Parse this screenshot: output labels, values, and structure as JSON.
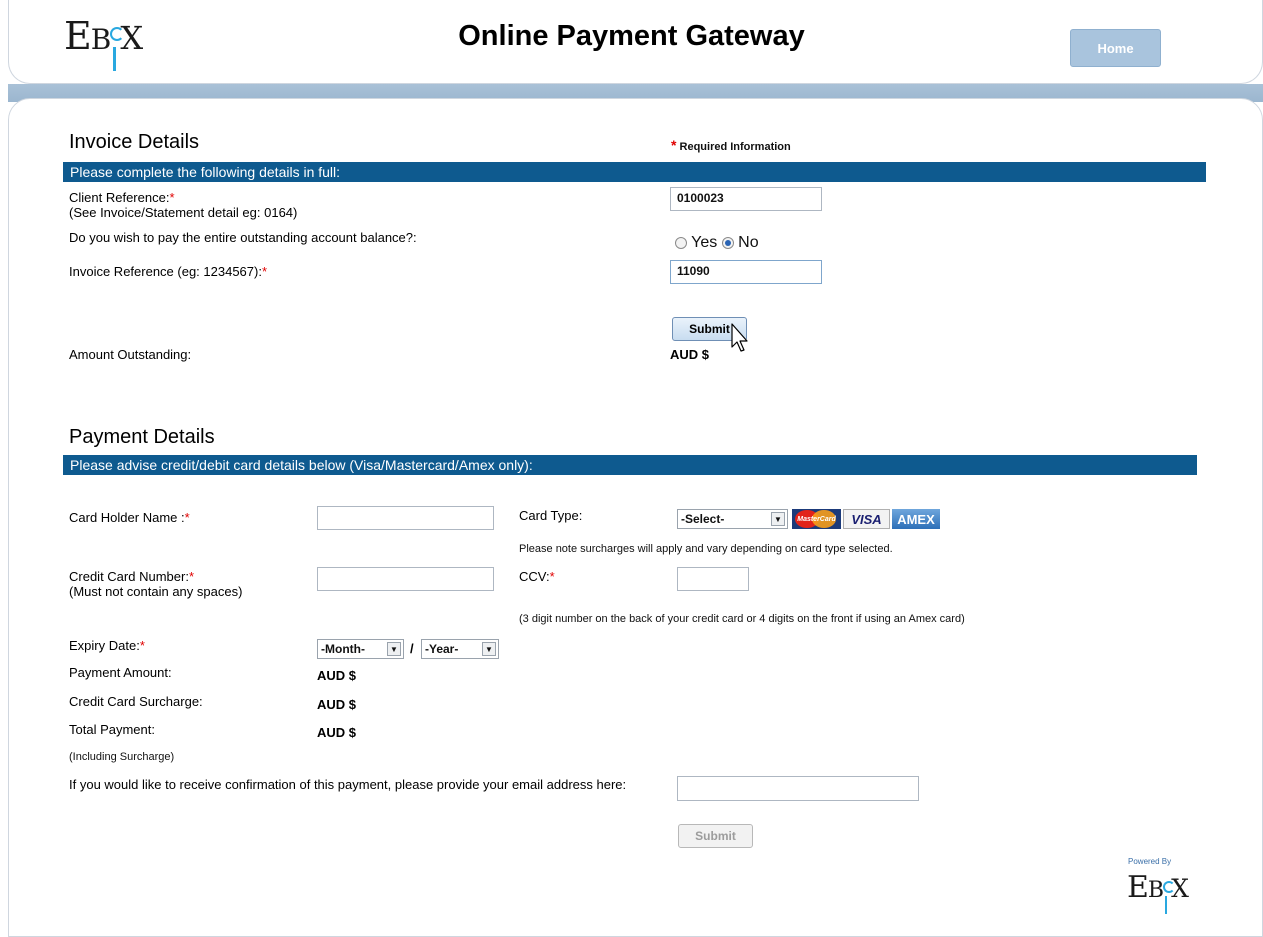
{
  "header": {
    "logo_text": "EBIX",
    "title": "Online Payment Gateway",
    "home_label": "Home"
  },
  "invoice": {
    "section_title": "Invoice Details",
    "required_note": "Required Information",
    "bar_text": "Please complete the following details in full:",
    "client_ref_label": "Client Reference:",
    "client_ref_hint": "(See Invoice/Statement detail eg: 0164)",
    "client_ref_value": "0100023",
    "pay_entire_label": "Do you wish to pay the entire outstanding account balance?:",
    "yes_label": "Yes",
    "no_label": "No",
    "selected_option": "No",
    "invoice_ref_label": "Invoice Reference (eg: 1234567):",
    "invoice_ref_value": "11090",
    "submit_label": "Submit",
    "amount_label": "Amount Outstanding:",
    "amount_value": "AUD $"
  },
  "payment": {
    "section_title": "Payment Details",
    "bar_text": "Please advise credit/debit card details below (Visa/Mastercard/Amex only):",
    "holder_label": "Card Holder Name :",
    "card_type_label": "Card Type:",
    "card_type_selected": "-Select-",
    "card_brands": [
      "MasterCard",
      "VISA",
      "AMEX"
    ],
    "surcharge_note": "Please note surcharges will apply and vary depending on card type selected.",
    "cc_number_label": "Credit Card Number:",
    "cc_number_hint": "(Must not contain any spaces)",
    "ccv_label": "CCV:",
    "ccv_hint": "(3 digit number on the back of your credit card or 4 digits on the front if using an Amex card)",
    "expiry_label": "Expiry Date:",
    "month_selected": "-Month-",
    "separator": "/",
    "year_selected": "-Year-",
    "payment_amount_label": "Payment Amount:",
    "payment_amount_value": "AUD $",
    "surcharge_label": "Credit Card Surcharge:",
    "surcharge_value": "AUD $",
    "total_label": "Total Payment:",
    "total_value": "AUD $",
    "total_hint": "(Including Surcharge)",
    "email_label": "If you would like to receive confirmation of this payment, please provide your email address here:",
    "submit_label": "Submit"
  },
  "footer": {
    "powered_by": "Powered By",
    "logo_text": "EBIX"
  },
  "colors": {
    "bar_blue": "#0e5a8f",
    "band_blue": "#a9c1d7",
    "home_button": "#a9c4dd",
    "required_red": "#e00000",
    "logo_accent": "#29a8e0"
  }
}
